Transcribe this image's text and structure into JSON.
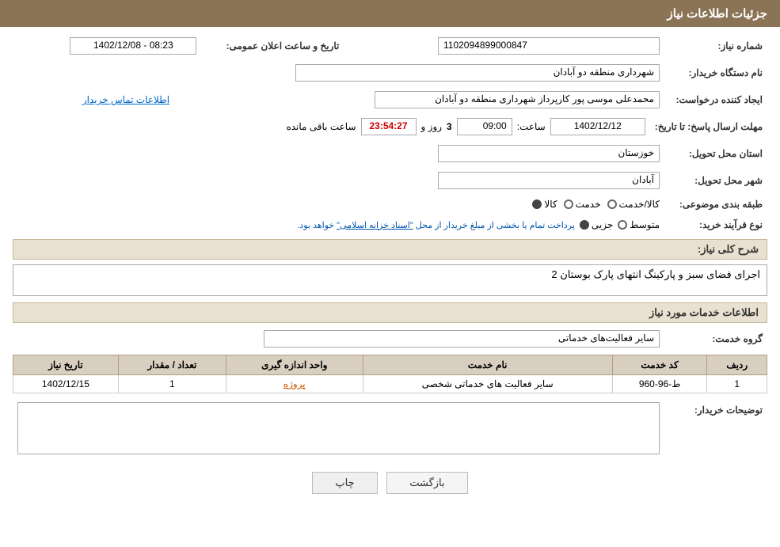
{
  "page": {
    "title": "جزئیات اطلاعات نیاز"
  },
  "header": {
    "title": "جزئیات اطلاعات نیاز"
  },
  "fields": {
    "need_number_label": "شماره نیاز:",
    "need_number_value": "1102094899000847",
    "announce_date_label": "تاریخ و ساعت اعلان عمومی:",
    "announce_date_value": "1402/12/08 - 08:23",
    "buyer_org_label": "نام دستگاه خریدار:",
    "buyer_org_value": "شهرداری منطقه دو آبادان",
    "creator_label": "ایجاد کننده درخواست:",
    "creator_value": "محمدعلی موسی پور کارپرداز شهرداری منطقه دو آبادان",
    "creator_link": "اطلاعات تماس خریدار",
    "deadline_label": "مهلت ارسال پاسخ: تا تاریخ:",
    "deadline_date": "1402/12/12",
    "deadline_time_label": "ساعت:",
    "deadline_time": "09:00",
    "deadline_days_label": "روز و",
    "deadline_days": "3",
    "deadline_remaining_label": "ساعت باقی مانده",
    "deadline_remaining": "23:54:27",
    "province_label": "استان محل تحویل:",
    "province_value": "خوزستان",
    "city_label": "شهر محل تحویل:",
    "city_value": "آبادان",
    "category_label": "طبقه بندی موضوعی:",
    "category_goods": "کالا",
    "category_service": "خدمت",
    "category_goods_service": "کالا/خدمت",
    "purchase_type_label": "نوع فرآیند خرید:",
    "purchase_type_part": "جزیی",
    "purchase_type_medium": "متوسط",
    "purchase_type_note": "پرداخت تمام یا بخشی از مبلغ خریدار از محل",
    "purchase_type_note2": "\"اسناد خزانه اسلامی\"",
    "purchase_type_note3": "خواهد بود.",
    "need_desc_label": "شرح کلی نیاز:",
    "need_desc_value": "اجرای فضای سبز و پارکینگ انتهای پارک بوستان 2",
    "services_section_title": "اطلاعات خدمات مورد نیاز",
    "service_group_label": "گروه خدمت:",
    "service_group_value": "سایر فعالیت‌های خدماتی",
    "table_headers": [
      "ردیف",
      "کد خدمت",
      "نام خدمت",
      "واحد اندازه گیری",
      "تعداد / مقدار",
      "تاریخ نیاز"
    ],
    "table_rows": [
      {
        "row": "1",
        "code": "ط-96-960",
        "name": "سایر فعالیت های خدماتی شخصی",
        "unit": "پروژه",
        "quantity": "1",
        "date": "1402/12/15"
      }
    ],
    "buyer_notes_label": "توضیحات خریدار:",
    "buyer_notes_value": ""
  },
  "buttons": {
    "back_label": "بازگشت",
    "print_label": "چاپ"
  }
}
